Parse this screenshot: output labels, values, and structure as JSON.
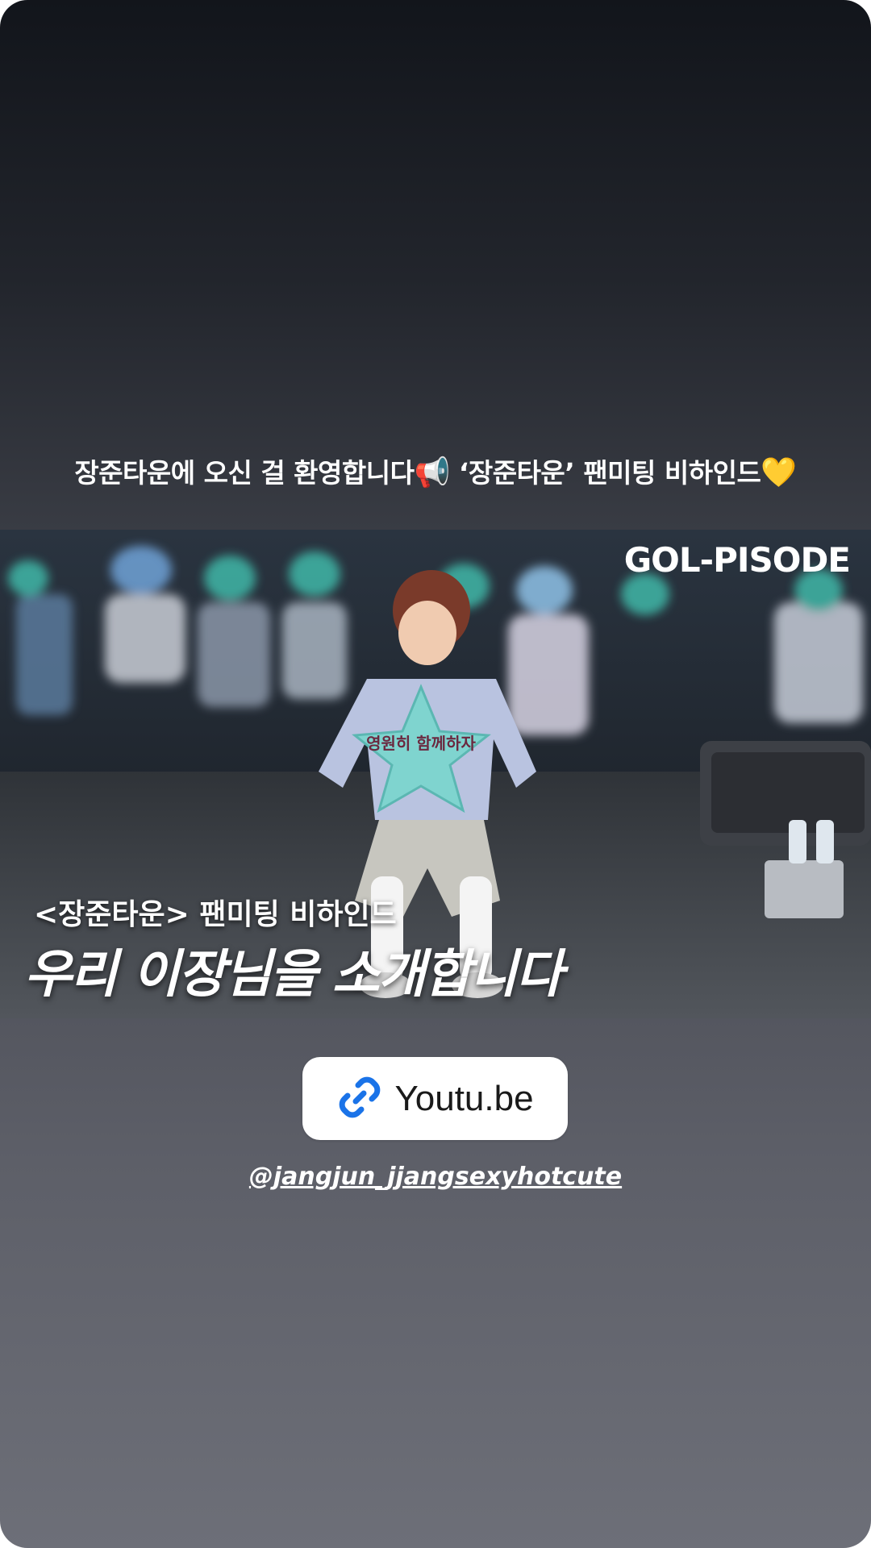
{
  "story": {
    "caption": "장준타운에 오신 걸 환영합니다",
    "caption_emoji_1": "📢",
    "caption_part2": "‘장준타운’ 팬미팅 비하인드",
    "caption_emoji_2": "💛",
    "thumbnail": {
      "channel_logo": "GOL-PISODE",
      "subtitle": "<장준타운> 팬미팅 비하인드",
      "headline": "우리 이장님을 소개합니다",
      "fan_sign_text": "영원히 함께하자"
    },
    "link_sticker": {
      "icon": "link-icon",
      "label": "Youtu.be",
      "icon_color": "#1a73e8"
    },
    "mention": "@jangjun_jjangsexyhotcute"
  }
}
